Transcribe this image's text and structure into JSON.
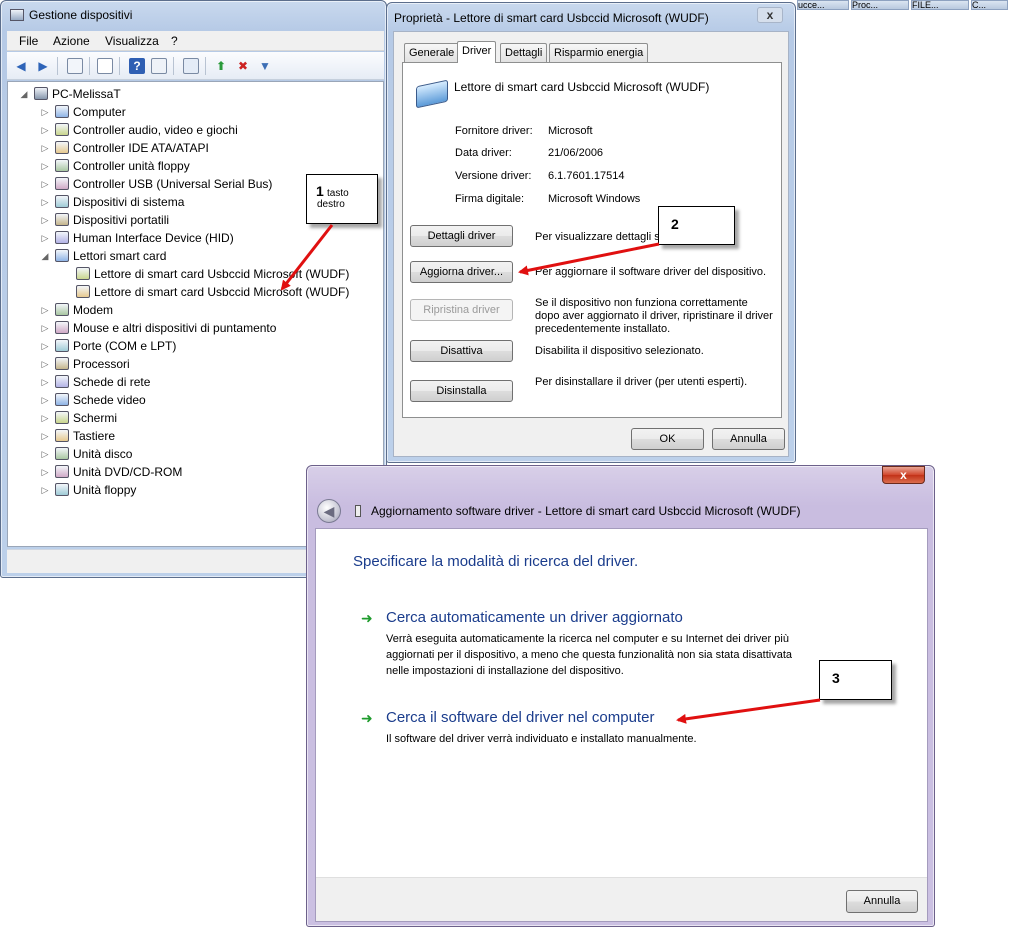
{
  "taskbar": [
    "ucce...",
    "Proc...",
    "FILE...",
    "C..."
  ],
  "device_manager": {
    "title": "Gestione dispositivi",
    "menu": [
      "File",
      "Azione",
      "Visualizza",
      "?"
    ],
    "tree": {
      "root": "PC-MelissaT",
      "items": [
        "Computer",
        "Controller audio, video e giochi",
        "Controller IDE ATA/ATAPI",
        "Controller unità floppy",
        "Controller USB (Universal Serial Bus)",
        "Dispositivi di sistema",
        "Dispositivi portatili",
        "Human Interface Device (HID)",
        "Lettori smart card",
        "Lettore di smart card Usbccid Microsoft (WUDF)",
        "Lettore di smart card Usbccid Microsoft (WUDF)",
        "Modem",
        "Mouse e altri dispositivi di puntamento",
        "Porte (COM e LPT)",
        "Processori",
        "Schede di rete",
        "Schede video",
        "Schermi",
        "Tastiere",
        "Unità disco",
        "Unità DVD/CD-ROM",
        "Unità floppy"
      ]
    }
  },
  "properties": {
    "title": "Proprietà - Lettore di smart card Usbccid Microsoft (WUDF)",
    "close": "x",
    "tabs": [
      "Generale",
      "Driver",
      "Dettagli",
      "Risparmio energia"
    ],
    "device_name": "Lettore di smart card Usbccid Microsoft (WUDF)",
    "fields": [
      {
        "label": "Fornitore driver:",
        "value": "Microsoft"
      },
      {
        "label": "Data driver:",
        "value": "21/06/2006"
      },
      {
        "label": "Versione driver:",
        "value": "6.1.7601.17514"
      },
      {
        "label": "Firma digitale:",
        "value": "Microsoft Windows"
      }
    ],
    "actions": [
      {
        "button": "Dettagli driver",
        "desc": "Per visualizzare dettagli s"
      },
      {
        "button": "Aggiorna driver...",
        "desc": "Per aggiornare il software driver del dispositivo."
      },
      {
        "button": "Ripristina driver",
        "desc": "Se il dispositivo non funziona correttamente dopo aver aggiornato il driver, ripristinare il driver precedentemente installato."
      },
      {
        "button": "Disattiva",
        "desc": "Disabilita il dispositivo selezionato."
      },
      {
        "button": "Disinstalla",
        "desc": "Per disinstallare il driver (per utenti esperti)."
      }
    ],
    "ok": "OK",
    "cancel": "Annulla"
  },
  "wizard": {
    "close": "x",
    "title": "Aggiornamento software driver - Lettore di smart card Usbccid Microsoft (WUDF)",
    "heading": "Specificare la modalità di ricerca del driver.",
    "options": [
      {
        "title": "Cerca automaticamente un driver aggiornato",
        "desc": "Verrà eseguita automaticamente la ricerca nel computer e su Internet dei driver più aggiornati per il dispositivo, a meno che questa funzionalità non sia stata disattivata nelle impostazioni di installazione del dispositivo."
      },
      {
        "title": "Cerca il software del driver nel computer",
        "desc": "Il software del driver verrà individuato e installato manualmente."
      }
    ],
    "cancel": "Annulla"
  },
  "annotations": {
    "c1_num": "1",
    "c1_text": "tasto destro",
    "c2_num": "2",
    "c3_num": "3",
    "arrow_color": "#e01010"
  }
}
